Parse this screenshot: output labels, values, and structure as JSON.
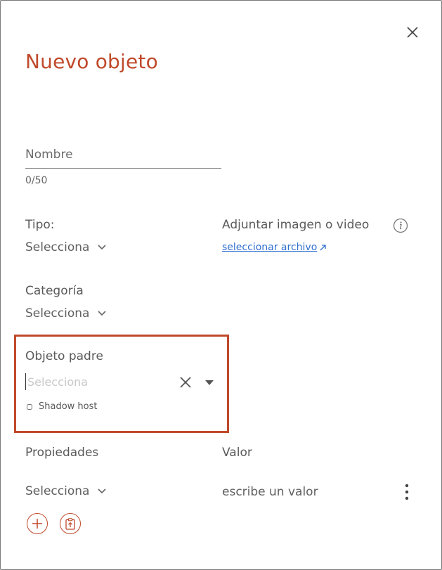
{
  "dialog": {
    "title": "Nuevo objeto",
    "close_icon": "close-icon"
  },
  "form": {
    "nombre": {
      "placeholder": "Nombre",
      "value": "",
      "counter": "0/50"
    },
    "tipo": {
      "label": "Tipo:",
      "selected": "Selecciona"
    },
    "adjuntar": {
      "label": "Adjuntar imagen o video",
      "link_text": "seleccionar archivo"
    },
    "categoria": {
      "label": "Categoría",
      "selected": "Selecciona"
    },
    "objeto_padre": {
      "label": "Objeto padre",
      "placeholder": "Selecciona",
      "shadow_host_label": "Shadow host",
      "shadow_host_checked": false
    },
    "propiedades": {
      "label": "Propiedades",
      "valor_label": "Valor",
      "selected": "Selecciona",
      "valor_text": "escribe un valor"
    }
  },
  "icons": {
    "add": "plus-circle-icon",
    "paste": "clipboard-upload-icon",
    "info": "info-icon",
    "more": "kebab-menu-icon",
    "external": "external-link-icon"
  },
  "colors": {
    "accent": "#c0492b",
    "link": "#2f6fcf",
    "text": "#5a5a5a"
  }
}
